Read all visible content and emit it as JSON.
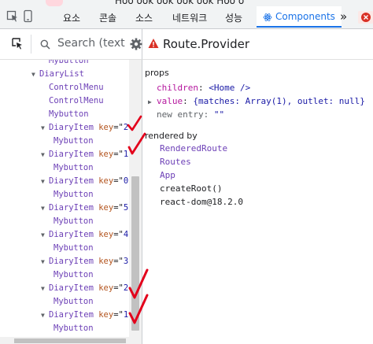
{
  "top_strip": {
    "text": "Hoo ook ook ook ook Hoo o"
  },
  "tabs": [
    {
      "label": "요소"
    },
    {
      "label": "콘솔"
    },
    {
      "label": "소스"
    },
    {
      "label": "네트워크"
    },
    {
      "label": "성능"
    },
    {
      "label": "Components"
    }
  ],
  "tabbar": {
    "more": "»"
  },
  "search": {
    "placeholder": "Search (text"
  },
  "component": {
    "title": "Route.Provider"
  },
  "tree": [
    {
      "name": "Mybutton",
      "indent": 4
    },
    {
      "name": "DiaryList",
      "indent": 3,
      "arrow": true
    },
    {
      "name": "ControlMenu",
      "indent": 4
    },
    {
      "name": "ControlMenu",
      "indent": 4
    },
    {
      "name": "Mybutton",
      "indent": 4
    },
    {
      "name": "DiaryItem",
      "indent": 4,
      "arrow": true,
      "key": "2"
    },
    {
      "name": "Mybutton",
      "indent": 5
    },
    {
      "name": "DiaryItem",
      "indent": 4,
      "arrow": true,
      "key": "1"
    },
    {
      "name": "Mybutton",
      "indent": 5
    },
    {
      "name": "DiaryItem",
      "indent": 4,
      "arrow": true,
      "key": "0"
    },
    {
      "name": "Mybutton",
      "indent": 5
    },
    {
      "name": "DiaryItem",
      "indent": 4,
      "arrow": true,
      "key": "5"
    },
    {
      "name": "Mybutton",
      "indent": 5
    },
    {
      "name": "DiaryItem",
      "indent": 4,
      "arrow": true,
      "key": "4"
    },
    {
      "name": "Mybutton",
      "indent": 5
    },
    {
      "name": "DiaryItem",
      "indent": 4,
      "arrow": true,
      "key": "3"
    },
    {
      "name": "Mybutton",
      "indent": 5
    },
    {
      "name": "DiaryItem",
      "indent": 4,
      "arrow": true,
      "key": "2"
    },
    {
      "name": "Mybutton",
      "indent": 5
    },
    {
      "name": "DiaryItem",
      "indent": 4,
      "arrow": true,
      "key": "1"
    },
    {
      "name": "Mybutton",
      "indent": 5
    }
  ],
  "tree_key_label": "key",
  "props": {
    "label": "props",
    "children_key": "children",
    "children_val": "<Home />",
    "value_key": "value",
    "value_val": "{matches: Array(1), outlet: null}",
    "new_entry_key": "new entry",
    "new_entry_val": "\"\""
  },
  "rendered_by": {
    "label": "rendered by",
    "items": [
      {
        "text": "RenderedRoute",
        "link": true
      },
      {
        "text": "Routes",
        "link": true
      },
      {
        "text": "App",
        "link": true
      },
      {
        "text": "createRoot()",
        "link": false
      },
      {
        "text": "react-dom@18.2.0",
        "link": false
      }
    ]
  },
  "colors": {
    "accent": "#1a73e8",
    "component_name": "#6c3fb6",
    "key": "#b3541e",
    "error_icon": "#d93025",
    "checkmark": "#e3001b"
  },
  "icons": [
    "inspect-element-icon",
    "device-toolbar-icon",
    "select-element-icon",
    "search-icon",
    "gear-icon",
    "warning-icon",
    "react-icon",
    "chevron-right-icon"
  ]
}
